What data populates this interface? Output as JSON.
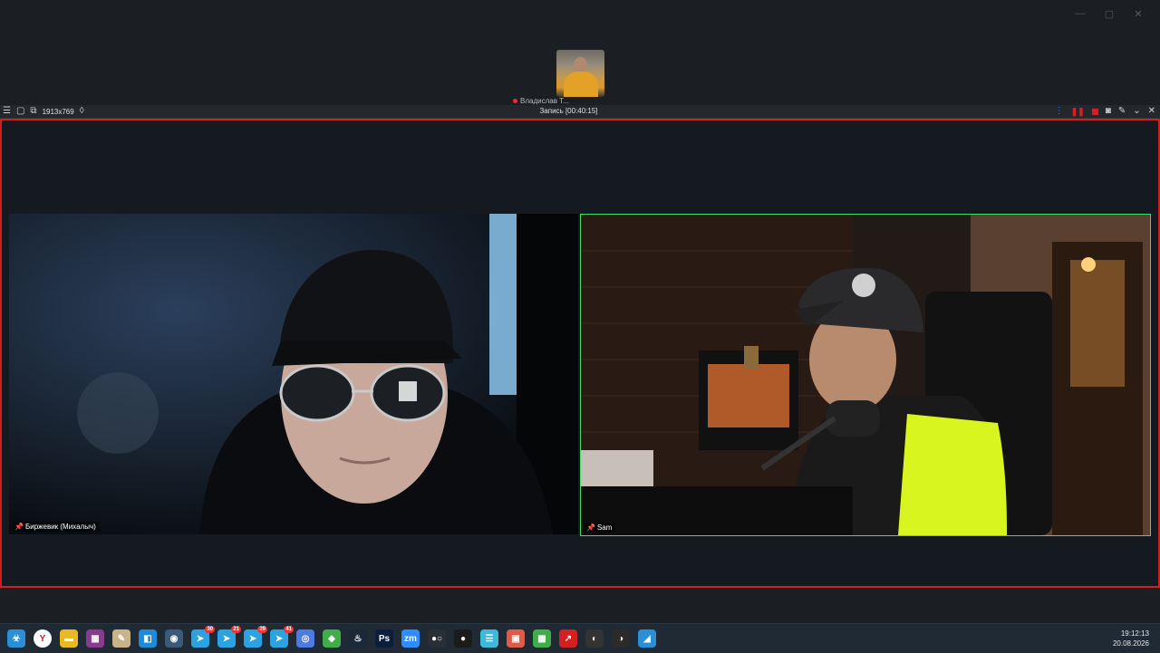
{
  "window_controls": [
    "—",
    "▢",
    "✕"
  ],
  "top_participant": {
    "name": "Владислав Т..."
  },
  "toolbar": {
    "resolution": "1913x769",
    "title": "Запись [00:40:15]"
  },
  "participants": [
    {
      "name": "Биржевик (Михалыч)"
    },
    {
      "name": "Sam"
    }
  ],
  "taskbar": {
    "icons": [
      {
        "name": "biohazard-icon",
        "glyph": "☣",
        "color": "#2a8fd6"
      },
      {
        "name": "yandex-browser-icon",
        "glyph": "Y",
        "color": "#ffffff"
      },
      {
        "name": "file-explorer-icon",
        "glyph": "▬",
        "color": "#e8b923"
      },
      {
        "name": "winrar-icon",
        "glyph": "▦",
        "color": "#8a3b8f"
      },
      {
        "name": "puzzle-icon",
        "glyph": "✎",
        "color": "#c9b48a"
      },
      {
        "name": "store-icon",
        "glyph": "◧",
        "color": "#1f8bd6"
      },
      {
        "name": "globe-icon",
        "glyph": "◉",
        "color": "#3b5a7a"
      },
      {
        "name": "telegram-icon",
        "glyph": "➤",
        "color": "#2aa3e0",
        "badge": "30"
      },
      {
        "name": "telegram-icon-2",
        "glyph": "➤",
        "color": "#2aa3e0",
        "badge": "21"
      },
      {
        "name": "telegram-icon-3",
        "glyph": "➤",
        "color": "#2aa3e0",
        "badge": "29"
      },
      {
        "name": "telegram-icon-4",
        "glyph": "➤",
        "color": "#2aa3e0",
        "badge": "41"
      },
      {
        "name": "chrome-icon",
        "glyph": "◎",
        "color": "#4c7be8"
      },
      {
        "name": "android-icon",
        "glyph": "◆",
        "color": "#3fae49"
      },
      {
        "name": "steam-icon",
        "glyph": "♨",
        "color": "#1b2838"
      },
      {
        "name": "photoshop-icon",
        "glyph": "Ps",
        "color": "#0c1d3d"
      },
      {
        "name": "zoom-icon",
        "glyph": "zm",
        "color": "#2d8cff"
      },
      {
        "name": "obs-dots-icon",
        "glyph": "●○",
        "color": "#2a2f35"
      },
      {
        "name": "record-icon",
        "glyph": "●",
        "color": "#1b1b1b"
      },
      {
        "name": "notes-icon",
        "glyph": "☰",
        "color": "#3fb8d9"
      },
      {
        "name": "pdf-icon",
        "glyph": "▣",
        "color": "#e05a4a"
      },
      {
        "name": "spreadsheet-icon",
        "glyph": "▦",
        "color": "#3fae49"
      },
      {
        "name": "arrow-app-icon",
        "glyph": "↗",
        "color": "#d32020"
      },
      {
        "name": "obs-icon",
        "glyph": "◐",
        "color": "#333333"
      },
      {
        "name": "obs-studio-icon",
        "glyph": "◑",
        "color": "#2b2b2b"
      },
      {
        "name": "paint-icon",
        "glyph": "◢",
        "color": "#2a8fd6"
      }
    ],
    "time": "19:12:13",
    "date": "20.08.2026"
  }
}
